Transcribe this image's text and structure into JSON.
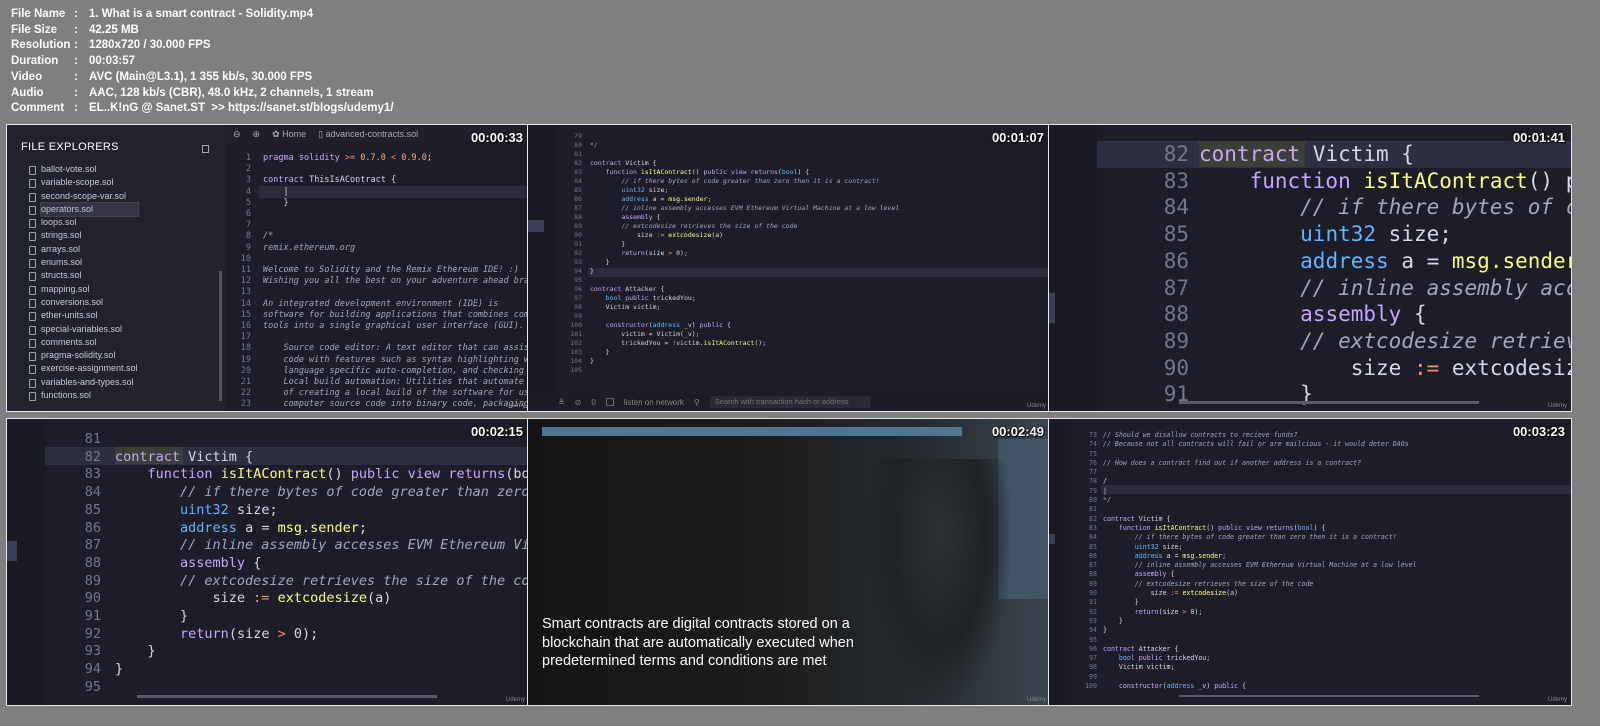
{
  "meta": {
    "rows": [
      {
        "key": "File Name",
        "value": "1. What is a smart contract - Solidity.mp4"
      },
      {
        "key": "File Size",
        "value": "42.25 MB"
      },
      {
        "key": "Resolution",
        "value": "1280x720 / 30.000 FPS"
      },
      {
        "key": "Duration",
        "value": "00:03:57"
      },
      {
        "key": "Video",
        "value": "AVC (Main@L3.1), 1 355 kb/s, 30.000 FPS"
      },
      {
        "key": "Audio",
        "value": "AAC, 128 kb/s (CBR), 48.0 kHz, 2 channels, 1 stream"
      },
      {
        "key": "Comment",
        "value": "EL..K!nG @ Sanet.ST  >> https://sanet.st/blogs/udemy1/"
      }
    ]
  },
  "watermark": "Udemy",
  "thumbs": [
    {
      "timestamp": "00:00:33",
      "explorer_title": "FILE EXPLORERS",
      "files": [
        "ballot-vote.sol",
        "variable-scope.sol",
        "second-scope-var.sol",
        "operators.sol",
        "loops.sol",
        "strings.sol",
        "arrays.sol",
        "enums.sol",
        "structs.sol",
        "mapping.sol",
        "conversions.sol",
        "ether-units.sol",
        "special-variables.sol",
        "comments.sol",
        "pragma-solidity.sol",
        "exercise-assignment.sol",
        "variables-and-types.sol",
        "functions.sol"
      ],
      "tabs": [
        "Home",
        "advanced-contracts.sol"
      ],
      "line_numbers": [
        "1",
        "2",
        "3",
        "4",
        "5",
        "6",
        "7",
        "8",
        "9",
        "10",
        "11",
        "12",
        "13",
        "14",
        "15",
        "16",
        "17",
        "18",
        "19",
        "20",
        "21",
        "22",
        "23"
      ],
      "code": [
        "pragma solidity >= 0.7.0 < 0.9.0;",
        "",
        "contract ThisIsAContract {",
        "    |",
        "    }",
        "",
        "",
        "/*",
        "remix.ethereum.org",
        "",
        "Welcome to Solidity and the Remix Ethereum IDE! :)",
        "Wishing you all the best on your adventure ahead bra",
        "",
        "An integrated development environment (IDE) is",
        "software for building applications that combines com",
        "tools into a single graphical user interface (GUI).",
        "",
        "    Source code editor: A text editor that can assis",
        "    code with features such as syntax highlighting w",
        "    language specific auto-completion, and checking",
        "    Local build automation: Utilities that automate",
        "    of creating a local build of the software for us",
        "    computer source code into binary code, packaging"
      ]
    },
    {
      "timestamp": "00:01:07",
      "line_numbers": [
        "79",
        "80",
        "81",
        "82",
        "83",
        "84",
        "85",
        "86",
        "87",
        "88",
        "89",
        "90",
        "91",
        "92",
        "93",
        "94",
        "95",
        "96",
        "97",
        "98",
        "99",
        "100",
        "101",
        "102",
        "103",
        "104",
        "105"
      ],
      "code": [
        "",
        "*/",
        "",
        "contract Victim {",
        "    function isItAContract() public view returns(bool) {",
        "        // if there bytes of code greater than zero then it is a contract!",
        "        uint32 size;",
        "        address a = msg.sender;",
        "        // inline assembly accesses EVM Ethereum Virtual Machine at a low level",
        "        assembly {",
        "        // extcodesize retrieves the size of the code",
        "            size := extcodesize(a)",
        "        }",
        "        return(size > 0);",
        "    }",
        "}",
        "",
        "contract Attacker {",
        "    bool public trickedYou;",
        "    Victim victim;",
        "",
        "    constructor(address _v) public {",
        "        victim = Victim(_v);",
        "        trickedYou = !victim.isItAContract();",
        "    }",
        "}",
        ""
      ],
      "bottom_listen": "listen on network",
      "bottom_count": "0",
      "search_placeholder": "Search with transaction hash or address"
    },
    {
      "timestamp": "00:01:41",
      "line_numbers": [
        "82",
        "83",
        "84",
        "85",
        "86",
        "87",
        "88",
        "89",
        "90",
        "91"
      ],
      "code": [
        "contract Victim {",
        "    function isItAContract() pu",
        "        // if there bytes of c",
        "        uint32 size;",
        "        address a = msg.sender",
        "        // inline assembly acc",
        "        assembly {",
        "        // extcodesize retriev",
        "            size := extcodesiz",
        "        }"
      ]
    },
    {
      "timestamp": "00:02:15",
      "line_numbers": [
        "81",
        "82",
        "83",
        "84",
        "85",
        "86",
        "87",
        "88",
        "89",
        "90",
        "91",
        "92",
        "93",
        "94",
        "95"
      ],
      "code": [
        "",
        "contract Victim {",
        "    function isItAContract() public view returns(boo",
        "        // if there bytes of code greater than zero",
        "        uint32 size;",
        "        address a = msg.sender;",
        "        // inline assembly accesses EVM Ethereum Vi",
        "        assembly {",
        "        // extcodesize retrieves the size of the co",
        "            size := extcodesize(a)",
        "        }",
        "        return(size > 0);",
        "    }",
        "}",
        ""
      ]
    },
    {
      "timestamp": "00:02:49",
      "caption": [
        "Smart contracts are digital contracts stored on a",
        "blockchain that are automatically executed when",
        "predetermined terms and conditions are met"
      ]
    },
    {
      "timestamp": "00:03:23",
      "line_numbers": [
        "73",
        "74",
        "75",
        "76",
        "77",
        "78",
        "79",
        "80",
        "81",
        "82",
        "83",
        "84",
        "85",
        "86",
        "87",
        "88",
        "89",
        "90",
        "91",
        "92",
        "93",
        "94",
        "95",
        "96",
        "97",
        "98",
        "99",
        "100"
      ],
      "code": [
        "// Should we disallow contracts to recieve funds?",
        "// Because not all contracts will fail or are mailcious - it would deter DAOs",
        "",
        "// How does a contract find out if another address is a contract?",
        "",
        "/",
        "|",
        "*/",
        "",
        "contract Victim {",
        "    function isItAContract() public view returns(bool) {",
        "        // if there bytes of code greater than zero then it is a contract!",
        "        uint32 size;",
        "        address a = msg.sender;",
        "        // inline assembly accesses EVM Ethereum Virtual Machine at a low level",
        "        assembly {",
        "        // extcodesize retrieves the size of the code",
        "            size := extcodesize(a)",
        "        }",
        "        return(size > 0);",
        "    }",
        "}",
        "",
        "contract Attacker {",
        "    bool public trickedYou;",
        "    Victim victim;",
        "",
        "    constructor(address _v) public {"
      ]
    }
  ]
}
